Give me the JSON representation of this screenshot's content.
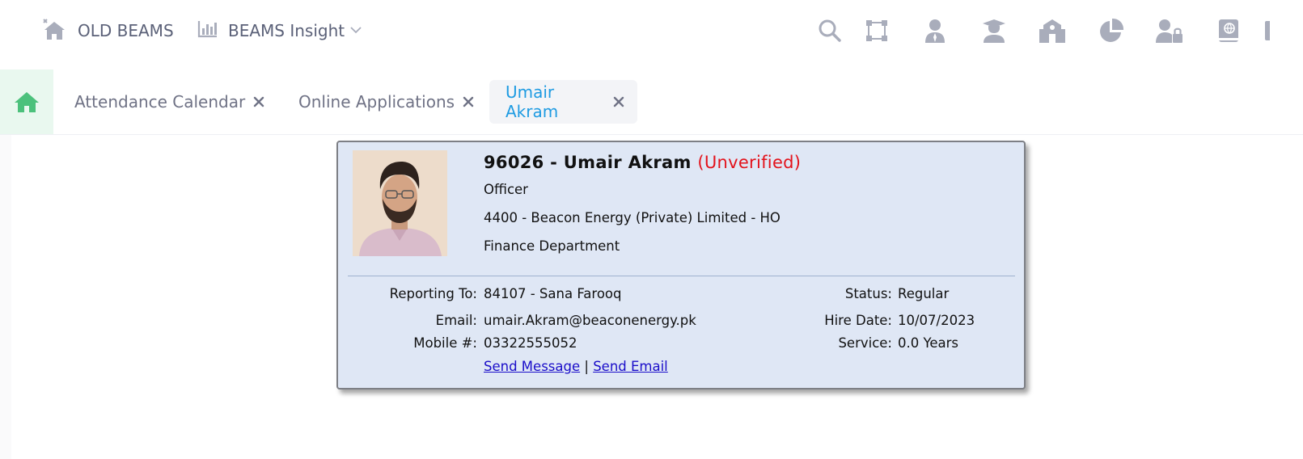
{
  "header": {
    "old_beams_label": "OLD BEAMS",
    "insight_label": "BEAMS Insight",
    "tools": [
      "search-icon",
      "diagram-icon",
      "employee-icon",
      "graduate-icon",
      "building-icon",
      "pie-chart-icon",
      "user-lock-icon",
      "book-icon"
    ]
  },
  "tabs": [
    {
      "label": "Attendance Calendar",
      "active": false
    },
    {
      "label": "Online Applications",
      "active": false
    },
    {
      "label": "Umair Akram",
      "active": true
    }
  ],
  "card": {
    "code_name": "96026 - Umair Akram",
    "verification": "(Unverified)",
    "designation": "Officer",
    "company": "4400 - Beacon Energy (Private) Limited - HO",
    "department": "Finance Department",
    "reporting_to_label": "Reporting To:",
    "reporting_to_value": "84107 - Sana Farooq",
    "email_label": "Email:",
    "email_value": "umair.Akram@beaconenergy.pk",
    "mobile_label": "Mobile #:",
    "mobile_value": "03322555052",
    "status_label": "Status:",
    "status_value": "Regular",
    "hire_date_label": "Hire Date:",
    "hire_date_value": "10/07/2023",
    "service_label": "Service:",
    "service_value": "0.0 Years",
    "send_message": "Send Message",
    "link_separator": "|",
    "send_email": "Send Email"
  },
  "colors": {
    "accent": "#1e9be2",
    "home_green": "#4cc17c",
    "unverified": "#e3121b",
    "card_bg": "#dfe7f5",
    "icon_gray": "#a9adbb"
  }
}
